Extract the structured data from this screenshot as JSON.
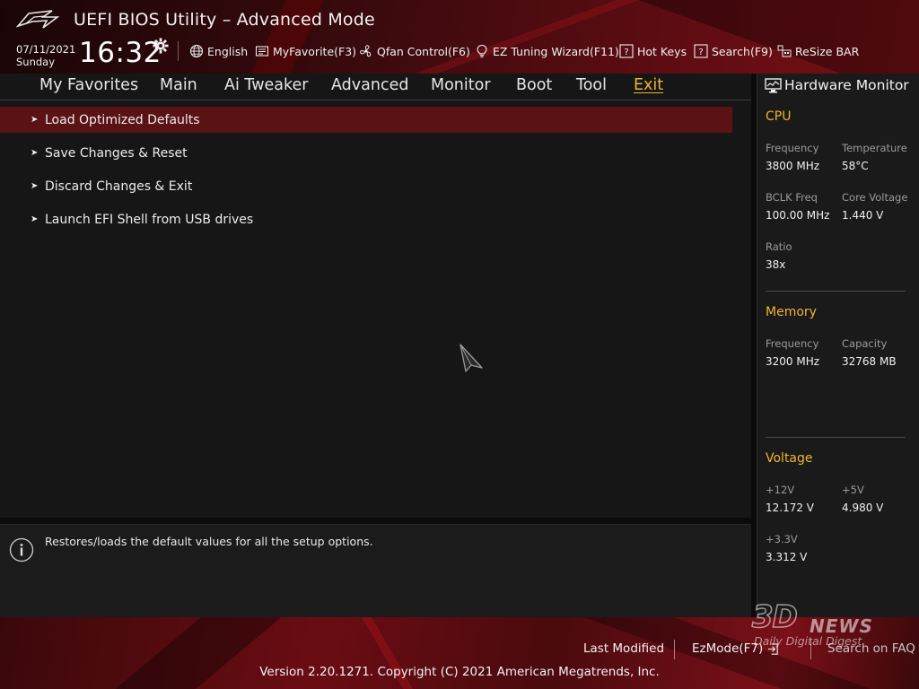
{
  "header": {
    "title": "UEFI BIOS Utility – Advanced Mode",
    "date": "07/11/2021",
    "day": "Sunday",
    "time": "16:32",
    "tools": [
      {
        "label": "English",
        "icon": "globe-icon"
      },
      {
        "label": "MyFavorite(F3)",
        "icon": "favorite-icon"
      },
      {
        "label": "Qfan Control(F6)",
        "icon": "fan-icon"
      },
      {
        "label": "EZ Tuning Wizard(F11)",
        "icon": "lightbulb-icon"
      },
      {
        "label": "Hot Keys",
        "icon": "question-icon"
      },
      {
        "label": "Search(F9)",
        "icon": "search-question-icon"
      },
      {
        "label": "ReSize BAR",
        "icon": "resize-bar-icon"
      }
    ]
  },
  "nav": {
    "tabs": [
      {
        "label": "My Favorites"
      },
      {
        "label": "Main"
      },
      {
        "label": "Ai Tweaker"
      },
      {
        "label": "Advanced"
      },
      {
        "label": "Monitor"
      },
      {
        "label": "Boot"
      },
      {
        "label": "Tool"
      },
      {
        "label": "Exit",
        "active": true
      }
    ]
  },
  "menu": {
    "items": [
      {
        "label": "Load Optimized Defaults",
        "selected": true
      },
      {
        "label": "Save Changes & Reset"
      },
      {
        "label": "Discard Changes & Exit"
      },
      {
        "label": "Launch EFI Shell from USB drives"
      }
    ]
  },
  "help": {
    "text": "Restores/loads the default values for all the setup options."
  },
  "hardware_monitor": {
    "title": "Hardware Monitor",
    "cpu": {
      "title": "CPU",
      "frequency_label": "Frequency",
      "frequency_value": "3800 MHz",
      "temperature_label": "Temperature",
      "temperature_value": "58°C",
      "bclk_label": "BCLK Freq",
      "bclk_value": "100.00 MHz",
      "core_voltage_label": "Core Voltage",
      "core_voltage_value": "1.440 V",
      "ratio_label": "Ratio",
      "ratio_value": "38x"
    },
    "memory": {
      "title": "Memory",
      "frequency_label": "Frequency",
      "frequency_value": "3200 MHz",
      "capacity_label": "Capacity",
      "capacity_value": "32768 MB"
    },
    "voltage": {
      "title": "Voltage",
      "v12_label": "+12V",
      "v12_value": "12.172 V",
      "v5_label": "+5V",
      "v5_value": "4.980 V",
      "v33_label": "+3.3V",
      "v33_value": "3.312 V"
    }
  },
  "footer": {
    "last_modified": "Last Modified",
    "ezmode": "EzMode(F7)",
    "search_faq": "Search on FAQ",
    "copyright": "Version 2.20.1271. Copyright (C) 2021 American Megatrends, Inc."
  },
  "watermark": {
    "logo": "3D",
    "news": "NEWS",
    "tagline": "Daily Digital Digest"
  },
  "colors": {
    "accent": "#f0b330",
    "selected_row": "#5a1214",
    "panel": "#161616"
  }
}
